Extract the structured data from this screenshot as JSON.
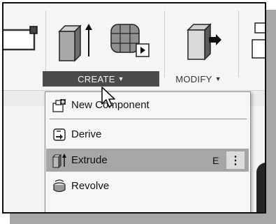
{
  "toolbar": {
    "create_label": "CREATE",
    "create_caret": "▼",
    "modify_label": "MODIFY",
    "modify_caret": "▼"
  },
  "menu": {
    "items": [
      {
        "label": "New Component",
        "icon": "new-component-icon"
      },
      {
        "label": "Derive",
        "icon": "derive-icon"
      },
      {
        "label": "Extrude",
        "icon": "extrude-icon",
        "shortcut": "E",
        "more": "⋮",
        "highlighted": true
      },
      {
        "label": "Revolve",
        "icon": "revolve-icon"
      }
    ]
  },
  "colors": {
    "create_active": "#4a4a4a",
    "highlight": "#a6a6a6",
    "canvas": "#262626"
  }
}
